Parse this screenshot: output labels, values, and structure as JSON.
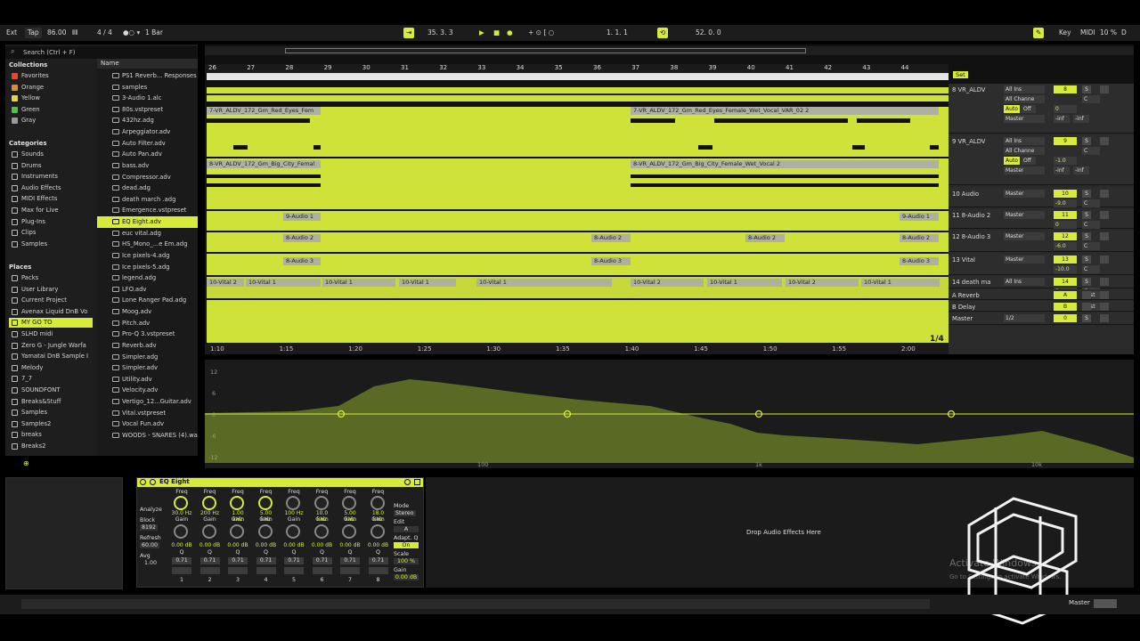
{
  "topbar": {
    "ext": "Ext",
    "tap": "Tap",
    "tempo": "86.00",
    "signature": "4 / 4",
    "quant": "1 Bar",
    "position": "35.  3.  3",
    "loop_start": "1.  1.  1",
    "loop_len": "52.  0.  0",
    "key": "Key",
    "midi": "MIDI",
    "cpu": "10 %",
    "d": "D"
  },
  "browser": {
    "search_placeholder": "Search (Ctrl + F)",
    "collections_title": "Collections",
    "collections": [
      {
        "label": "Favorites",
        "color": "#e0463a"
      },
      {
        "label": "Orange",
        "color": "#e08a2a"
      },
      {
        "label": "Yellow",
        "color": "#e6d63a"
      },
      {
        "label": "Green",
        "color": "#4cc24a"
      },
      {
        "label": "Gray",
        "color": "#9a9a9a"
      }
    ],
    "categories_title": "Categories",
    "categories": [
      "Sounds",
      "Drums",
      "Instruments",
      "Audio Effects",
      "MIDI Effects",
      "Max for Live",
      "Plug-Ins",
      "Clips",
      "Samples"
    ],
    "places_title": "Places",
    "places": [
      "Packs",
      "User Library",
      "Current Project",
      "Avenax Liquid DnB Vo",
      "MY GO TO",
      "SLHD midi",
      "Zero G - Jungle Warfa",
      "Yamatai DnB Sample I",
      "Melody",
      "7_7",
      "SOUNDFONT",
      "Breaks&Stuff",
      "Samples",
      "Samples2",
      "breaks",
      "Breaks2"
    ],
    "places_selected": 4,
    "name_header": "Name",
    "files": [
      "PS1 Reverb... Responses",
      "samples",
      "3-Audio 1.alc",
      "80s.vstpreset",
      "432hz.adg",
      "Arpeggiator.adv",
      "Auto Filter.adv",
      "Auto Pan.adv",
      "bass.adv",
      "Compressor.adv",
      "dead.adg",
      "death march .adg",
      "Emergence.vstpreset",
      "EQ Eight.adv",
      "euc vital.adg",
      "HS_Mono_...e Em.adg",
      "Ice pixels-4.adg",
      "Ice pixels-5.adg",
      "legend.adg",
      "LFO.adv",
      "Lone Ranger Pad.adg",
      "Moog.adv",
      "Pitch.adv",
      "Pro-Q 3.vstpreset",
      "Reverb.adv",
      "Simpler.adg",
      "Simpler.adv",
      "Utility.adv",
      "Velocity.adv",
      "Vertigo_12...Guitar.adv",
      "Vital.vstpreset",
      "Vocal Fun.adv",
      "WOODS - SNARES (4).wav"
    ],
    "files_selected": 13
  },
  "arrangement": {
    "bars": [
      "26",
      "27",
      "28",
      "29",
      "30",
      "31",
      "32",
      "33",
      "34",
      "35",
      "36",
      "37",
      "38",
      "39",
      "40",
      "41",
      "42",
      "43",
      "44"
    ],
    "times": [
      "1:10",
      "1:15",
      "1:20",
      "1:25",
      "1:30",
      "1:35",
      "1:40",
      "1:45",
      "1:50",
      "1:55",
      "2:00"
    ],
    "page": "1/4",
    "set_label": "Set",
    "clips": {
      "vocal_a": "7-VR_ALDV_172_Gm_Red_Eyes_Fem",
      "vocal_a2": "7-VR_ALDV_172_Gm_Red_Eyes_Female_Wet_Vocal_VAR_02 2",
      "vocal_b": "8-VR_ALDV_172_Gm_Big_City_Femal",
      "vocal_b2": "8-VR_ALDV_172_Gm_Big_City_Female_Wet_Vocal 2",
      "audio1": "9-Audio 1",
      "audio2": "8-Audio 2",
      "audio3": "8-Audio 3",
      "vital1": "10-Vital 1",
      "vital2": "10-Vital 2"
    },
    "tracks": [
      {
        "name": "8 VR_ALDV",
        "input": "All Ins",
        "channel": "All Channe",
        "out": "Master",
        "num": "8",
        "vol": "0",
        "pan": "C",
        "send_a": "-inf",
        "send_b": "-inf"
      },
      {
        "name": "9 VR_ALDV",
        "input": "All Ins",
        "channel": "All Channe",
        "out": "Master",
        "num": "9",
        "vol": "-1.0",
        "pan": "C",
        "send_a": "-inf",
        "send_b": "-inf"
      },
      {
        "name": "10 Audio",
        "out": "Master",
        "num": "10",
        "vol": "-9.0",
        "pan": "C"
      },
      {
        "name": "11 8-Audio 2",
        "out": "Master",
        "num": "11",
        "vol": "0",
        "pan": "C"
      },
      {
        "name": "12 8-Audio 3",
        "out": "Master",
        "num": "12",
        "vol": "-6.0",
        "pan": "C"
      },
      {
        "name": "13 Vital",
        "out": "Master",
        "num": "13",
        "vol": "-10.0",
        "pan": "C"
      },
      {
        "name": "14 death ma",
        "input": "All Ins",
        "num": "14",
        "vol": "0",
        "pan": "C"
      },
      {
        "name": "A Reverb",
        "num": "A",
        "tag": "Post"
      },
      {
        "name": "B Delay",
        "num": "B",
        "tag": "Post"
      },
      {
        "name": "Master",
        "input": "1/2",
        "num": "0"
      }
    ],
    "auto_label": "Auto",
    "off_label": "Off",
    "s_label": "S"
  },
  "eq_display": {
    "db_labels": [
      "12",
      "6",
      "0",
      "-6",
      "-12"
    ],
    "freq_labels": [
      "100",
      "1k",
      "10k"
    ]
  },
  "device": {
    "title": "EQ Eight",
    "analyze": "Analyze",
    "block_label": "Block",
    "block_value": "8192",
    "refresh_label": "Refresh",
    "refresh_value": "60.00",
    "avg_label": "Avg",
    "avg_value": "1.00",
    "bands": [
      {
        "freq": "30.0 Hz",
        "gain": "0.00 dB",
        "q": "0.71",
        "n": "1"
      },
      {
        "freq": "200 Hz",
        "gain": "0.00 dB",
        "q": "0.71",
        "n": "2"
      },
      {
        "freq": "1.00 kHz",
        "gain": "0.00 dB",
        "q": "0.71",
        "n": "3"
      },
      {
        "freq": "5.00 kHz",
        "gain": "0.00 dB",
        "q": "0.71",
        "n": "4"
      },
      {
        "freq": "100 Hz",
        "gain": "0.00 dB",
        "q": "0.71",
        "n": "5"
      },
      {
        "freq": "10.0 kHz",
        "gain": "0.00 dB",
        "q": "0.71",
        "n": "6"
      },
      {
        "freq": "5.00 kHz",
        "gain": "0.00 dB",
        "q": "0.71",
        "n": "7"
      },
      {
        "freq": "18.0 kHz",
        "gain": "0.00 dB",
        "q": "0.71",
        "n": "8"
      }
    ],
    "freq_label": "Freq",
    "gain_label": "Gain",
    "q_label": "Q",
    "mode_label": "Mode",
    "mode_value": "Stereo",
    "edit_label": "Edit",
    "edit_value": "A",
    "adapt_label": "Adapt. Q",
    "adapt_value": "On",
    "scale_label": "Scale",
    "scale_value": "100 %",
    "out_gain_label": "Gain",
    "out_gain_value": "0.00 dB",
    "drop_text": "Drop Audio Effects Here"
  },
  "statusbar": {
    "master": "Master"
  },
  "watermark": {
    "line1": "Activate Windows",
    "line2": "Go to Settings to activate Windows."
  }
}
